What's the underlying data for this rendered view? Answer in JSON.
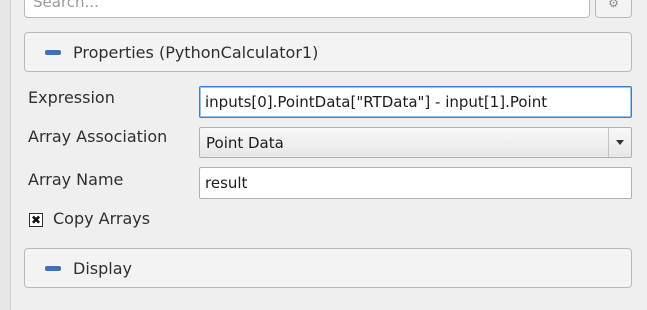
{
  "search": {
    "value": "Search...",
    "button_label": "⚙"
  },
  "properties_section": {
    "title": "Properties (PythonCalculator1)",
    "fields": {
      "expression": {
        "label": "Expression",
        "value": "inputs[0].PointData[\"RTData\"] - input[1].Point"
      },
      "array_association": {
        "label": "Array Association",
        "value": "Point Data"
      },
      "array_name": {
        "label": "Array Name",
        "value": "result"
      }
    },
    "copy_arrays": {
      "label": "Copy Arrays",
      "checked": true,
      "check_glyph": "✖"
    }
  },
  "display_section": {
    "title": "Display"
  },
  "icons": {
    "collapse": "minus-icon",
    "accent_color": "#3d72b6"
  }
}
